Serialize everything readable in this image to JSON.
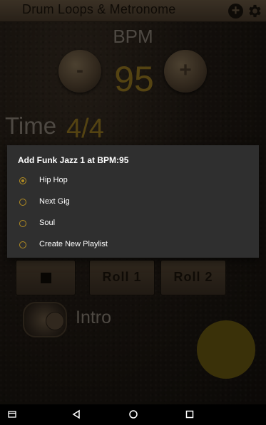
{
  "app": {
    "title": "Drum Loops & Metronome"
  },
  "bpm": {
    "label": "BPM",
    "value": "95",
    "minus_symbol": "-",
    "plus_symbol": "+"
  },
  "time": {
    "label": "Time",
    "value": "4/4"
  },
  "controls": {
    "roll1": "Roll 1",
    "roll2": "Roll 2"
  },
  "intro": {
    "label": "Intro"
  },
  "dialog": {
    "title": "Add Funk Jazz 1 at BPM:95",
    "options": [
      {
        "label": "Hip Hop",
        "checked": true
      },
      {
        "label": "Next Gig",
        "checked": false
      },
      {
        "label": "Soul",
        "checked": false
      },
      {
        "label": "Create New Playlist",
        "checked": false
      }
    ]
  },
  "icons": {
    "add": "add-circle-icon",
    "settings": "gear-icon",
    "nav_recent": "recents-icon",
    "nav_back": "back-icon",
    "nav_home": "home-icon",
    "nav_overview": "overview-icon"
  },
  "colors": {
    "accent": "#b38d22",
    "bpm_value": "#9a7a22",
    "dialog_bg": "#2f2f2f"
  }
}
